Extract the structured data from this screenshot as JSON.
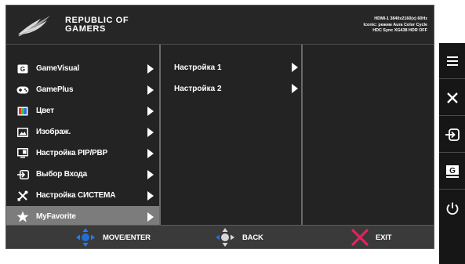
{
  "header": {
    "brand_line1": "REPUBLIC OF",
    "brand_line2": "GAMERS",
    "status_line1": "HDMI-1 3840x2160(x) 60Hz",
    "status_line2": "Iconic: режим Aura Color Cycle",
    "status_line3": "HDC Sync XG438 HDR OFF"
  },
  "menu": {
    "items": [
      {
        "label": "GameVisual",
        "icon": "gamevisual-icon"
      },
      {
        "label": "GamePlus",
        "icon": "gamepad-icon"
      },
      {
        "label": "Цвет",
        "icon": "color-palette-icon"
      },
      {
        "label": "Изображ.",
        "icon": "image-icon"
      },
      {
        "label": "Настройка PIP/PBP",
        "icon": "pip-pbp-icon"
      },
      {
        "label": "Выбор Входа",
        "icon": "input-select-icon"
      },
      {
        "label": "Настройка СИСТЕМА",
        "icon": "wrench-screwdriver-icon"
      },
      {
        "label": "MyFavorite",
        "icon": "star-icon"
      }
    ],
    "selected_item": "MyFavorite",
    "submenu": [
      {
        "label": "Настройка 1"
      },
      {
        "label": "Настройка 2"
      }
    ]
  },
  "footer": {
    "move_label": "MOVE/ENTER",
    "back_label": "BACK",
    "exit_label": "EXIT"
  },
  "sidebar": {
    "buttons": [
      "menu-icon",
      "close-icon",
      "input-icon",
      "gamevisual-icon",
      "power-icon"
    ]
  },
  "colors": {
    "osd_background": "#232323",
    "selected_row": "#7c7c7c",
    "joystick_accent": "#1f6fd6",
    "exit_accent": "#e0245e"
  }
}
